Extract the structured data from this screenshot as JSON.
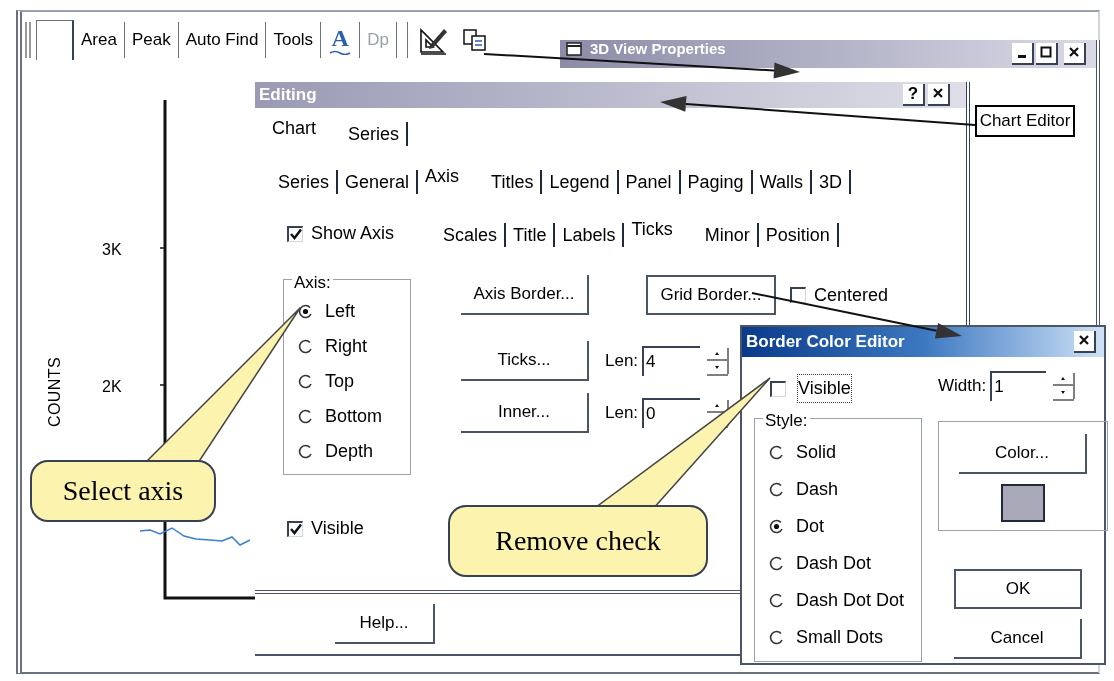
{
  "toolbar": {
    "items": [
      {
        "kind": "text",
        "label": "Area",
        "disabled": false
      },
      {
        "kind": "text",
        "label": "Peak",
        "disabled": false
      },
      {
        "kind": "text",
        "label": "Auto Find",
        "disabled": false
      },
      {
        "kind": "text",
        "label": "Tools",
        "disabled": false
      },
      {
        "kind": "glyph",
        "label": "A"
      },
      {
        "kind": "text",
        "label": "Dp",
        "disabled": true
      },
      {
        "kind": "ruler-pencil"
      },
      {
        "kind": "copy"
      }
    ]
  },
  "chart": {
    "ylabel": "COUNTS",
    "y_tick_labels": [
      "3K",
      "2K"
    ]
  },
  "view_window": {
    "title": "3D View Properties",
    "chart_editor_button": "Chart Editor"
  },
  "editing": {
    "title": "Editing",
    "help_button": "?",
    "tabs": [
      {
        "label": "Chart",
        "selected": true
      },
      {
        "label": "Series",
        "selected": false
      }
    ],
    "subtabs": [
      {
        "label": "Series",
        "selected": false
      },
      {
        "label": "General",
        "selected": false
      },
      {
        "label": "Axis",
        "selected": true
      },
      {
        "label": "Titles",
        "selected": false
      },
      {
        "label": "Legend",
        "selected": false
      },
      {
        "label": "Panel",
        "selected": false
      },
      {
        "label": "Paging",
        "selected": false
      },
      {
        "label": "Walls",
        "selected": false
      },
      {
        "label": "3D",
        "selected": false
      }
    ],
    "show_axis": {
      "label": "Show Axis",
      "checked": true
    },
    "axis_tabs": [
      {
        "label": "Scales",
        "selected": false
      },
      {
        "label": "Title",
        "selected": false
      },
      {
        "label": "Labels",
        "selected": false
      },
      {
        "label": "Ticks",
        "selected": true
      },
      {
        "label": "Minor",
        "selected": false
      },
      {
        "label": "Position",
        "selected": false
      }
    ],
    "axis_group": {
      "label": "Axis:",
      "options": [
        {
          "label": "Left",
          "selected": true
        },
        {
          "label": "Right",
          "selected": false
        },
        {
          "label": "Top",
          "selected": false
        },
        {
          "label": "Bottom",
          "selected": false
        },
        {
          "label": "Depth",
          "selected": false
        }
      ]
    },
    "axis_border_button": "Axis Border...",
    "grid_border_button": "Grid Border...",
    "centered": {
      "label": "Centered",
      "checked": false
    },
    "ticks_button": "Ticks...",
    "ticks_len": {
      "label": "Len:",
      "value": "4"
    },
    "inner_button": "Inner...",
    "inner_len": {
      "label": "Len:",
      "value": "0"
    },
    "visible": {
      "label": "Visible",
      "checked": true
    },
    "help": "Help..."
  },
  "border_editor": {
    "title": "Border Color Editor",
    "visible": {
      "label": "Visible",
      "checked": false
    },
    "width": {
      "label": "Width:",
      "value": "1"
    },
    "style_group": {
      "label": "Style:",
      "options": [
        {
          "label": "Solid",
          "selected": false
        },
        {
          "label": "Dash",
          "selected": false
        },
        {
          "label": "Dot",
          "selected": true
        },
        {
          "label": "Dash Dot",
          "selected": false
        },
        {
          "label": "Dash Dot Dot",
          "selected": false
        },
        {
          "label": "Small Dots",
          "selected": false
        }
      ]
    },
    "color_button": "Color...",
    "color": "#a9a9ba",
    "ok": "OK",
    "cancel": "Cancel"
  },
  "callouts": [
    {
      "text": "Select axis"
    },
    {
      "text": "Remove check"
    }
  ]
}
